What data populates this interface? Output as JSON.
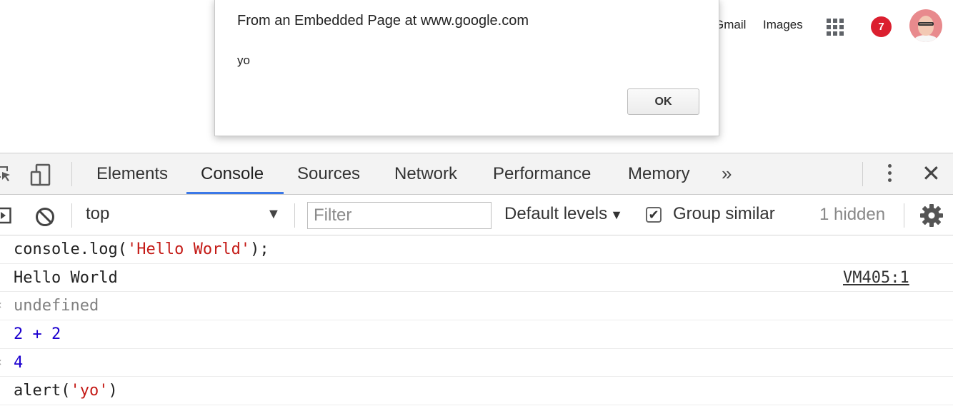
{
  "google_header": {
    "gmail_label": "Gmail",
    "images_label": "Images",
    "apps_icon": "apps-grid-icon",
    "notification_count": "7",
    "badge_color": "#db1f2f"
  },
  "alert": {
    "title": "From an Embedded Page at www.google.com",
    "message": "yo",
    "ok_label": "OK"
  },
  "devtools": {
    "tabs": [
      {
        "label": "Elements"
      },
      {
        "label": "Console",
        "active": true
      },
      {
        "label": "Sources"
      },
      {
        "label": "Network"
      },
      {
        "label": "Performance"
      },
      {
        "label": "Memory"
      }
    ],
    "more_tabs_label": "»",
    "active_tab_color": "#3b78e7",
    "toolbar": {
      "context": "top",
      "context_arrow": "▼",
      "filter_placeholder": "Filter",
      "levels_label": "Default levels",
      "levels_arrow": "▼",
      "group_similar_checked": true,
      "group_similar_label": "Group similar",
      "hidden_count": "1 hidden"
    }
  },
  "console": {
    "entries": [
      {
        "type": "input",
        "parts": [
          {
            "text": "console.log(",
            "kind": "plain"
          },
          {
            "text": "'Hello World'",
            "kind": "string"
          },
          {
            "text": ");",
            "kind": "plain"
          }
        ]
      },
      {
        "type": "log",
        "text": "Hello World",
        "source": "VM405:1"
      },
      {
        "type": "result",
        "text": "undefined"
      },
      {
        "type": "input",
        "parts": [
          {
            "text": "2 + 2",
            "kind": "number"
          }
        ]
      },
      {
        "type": "result",
        "text": "4"
      },
      {
        "type": "input",
        "parts": [
          {
            "text": "alert(",
            "kind": "plain"
          },
          {
            "text": "'yo'",
            "kind": "string"
          },
          {
            "text": ")",
            "kind": "plain"
          }
        ]
      }
    ],
    "colors": {
      "string": "#c41a16",
      "number": "#1c00cf",
      "undefined": "#808080"
    }
  }
}
